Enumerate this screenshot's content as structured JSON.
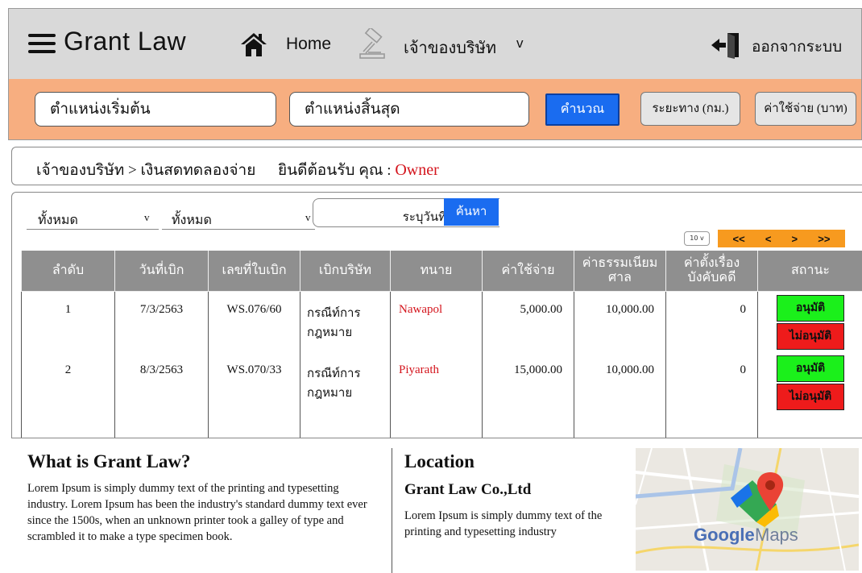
{
  "navbar": {
    "brand": "Grant Law",
    "home_label": "Home",
    "company_menu": "เจ้าของบริษัท",
    "company_chevron": "v",
    "logout_label": "ออกจากระบบ"
  },
  "searchbar": {
    "start_location": "ตำแหน่งเริ่มต้น",
    "end_location": "ตำแหน่งสิ้นสุด",
    "calc_button": "คำนวณ",
    "distance_button": "ระยะทาง (กม.)",
    "cost_button": "ค่าใช้จ่าย (บาท)"
  },
  "breadcrumb": {
    "path": "เจ้าของบริษัท > เงินสดทดลองจ่าย",
    "welcome": "ยินดีต้อนรับ คุณ : ",
    "user": "Owner"
  },
  "filters": {
    "filter1": "ทั้งหมด",
    "filter1_chevron": "v",
    "filter2": "ทั้งหมด",
    "filter2_chevron": "v",
    "date_placeholder": "ระบุวันที่",
    "search_button": "ค้นหา",
    "page_size": "10 v",
    "pager": {
      "first": "<<",
      "prev": "<",
      "next": ">",
      "last": ">>"
    }
  },
  "table": {
    "headers": [
      "ลำดับ",
      "วันที่เบิก",
      "เลขที่ใบเบิก",
      "เบิกบริษัท",
      "ทนาย",
      "ค่าใช้จ่าย",
      "ค่าธรรมเนียมศาล",
      "ค่าตั้งเรื่องบังคับคดี",
      "สถานะ"
    ],
    "rows": [
      {
        "no": "1",
        "date": "7/3/2563",
        "doc_no": "WS.076/60",
        "company": "กรณีท์การกฎหมาย",
        "lawyer": "Nawapol",
        "expense": "5,000.00",
        "court_fee": "10,000.00",
        "enforcement_fee": "0"
      },
      {
        "no": "2",
        "date": "8/3/2563",
        "doc_no": "WS.070/33",
        "company": "กรณีท์การกฎหมาย",
        "lawyer": "Piyarath",
        "expense": "15,000.00",
        "court_fee": "10,000.00",
        "enforcement_fee": "0"
      }
    ],
    "approve_label": "อนุมัติ",
    "reject_label": "ไม่อนุมัติ"
  },
  "footer": {
    "about_title": "What is Grant Law?",
    "about_text": "Lorem Ipsum is simply dummy text of the printing and typesetting industry. Lorem Ipsum has been the industry's standard dummy text ever since the 1500s, when an unknown printer took a galley of type and scrambled it to make a type specimen book.",
    "location_title": "Location",
    "location_company": "Grant Law Co.,Ltd",
    "location_text": "Lorem Ipsum is simply dummy text of the printing and typesetting industry",
    "map_brand_google": "Google",
    "map_brand_maps": " Maps"
  },
  "colors": {
    "navbar_bg": "#d9d9d9",
    "searchbar_bg": "#f7ae80",
    "primary_button": "#1a6cf0",
    "approve": "#1bf01b",
    "reject": "#ee1b1b",
    "pager": "#f79a1f",
    "accent_red": "#d4141c"
  },
  "icons": [
    "menu-icon",
    "home-icon",
    "gavel-icon",
    "logout-icon",
    "map-pin-icon"
  ]
}
